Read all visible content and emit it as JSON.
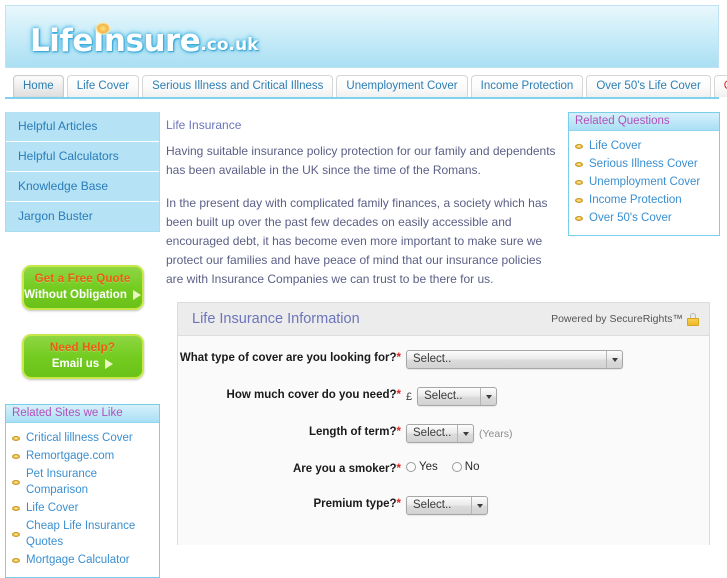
{
  "site": {
    "logo_main": "LifeInsure",
    "logo_tld": ".co.uk"
  },
  "nav": {
    "tabs": [
      {
        "label": "Home",
        "active": true
      },
      {
        "label": "Life Cover",
        "active": false
      },
      {
        "label": "Serious Illness and Critical Illness",
        "active": false
      },
      {
        "label": "Unemployment Cover",
        "active": false
      },
      {
        "label": "Income Protection",
        "active": false
      },
      {
        "label": "Over 50's Life Cover",
        "active": false
      },
      {
        "label": "Get a Quote",
        "active": false,
        "style": "quote"
      }
    ]
  },
  "sidebar_left": {
    "nav_items": [
      {
        "label": "Helpful Articles"
      },
      {
        "label": "Helpful Calculators"
      },
      {
        "label": "Knowledge Base"
      },
      {
        "label": "Jargon Buster"
      }
    ],
    "cta_quote": {
      "top": "Get a Free Quote",
      "bottom": "Without Obligation"
    },
    "cta_help": {
      "top": "Need Help?",
      "bottom": "Email us"
    },
    "related_sites": {
      "title": "Related Sites we Like",
      "links": [
        "Critical lillness Cover",
        "Remortgage.com",
        "Pet Insurance Comparison",
        "Life Cover",
        "Cheap Life Insurance Quotes",
        "Mortgage Calculator"
      ]
    }
  },
  "main": {
    "title": "Life Insurance",
    "paragraphs": [
      "Having suitable insurance policy protection for our family and dependents has been available in the UK since the time of the Romans.",
      "In the present day with complicated family finances, a society which has been built up over the past few decades on easily accessible and encouraged debt, it has become even more important to make sure we protect our families and have peace of mind that our insurance policies are with Insurance Companies we can trust to be there for us."
    ]
  },
  "sidebar_right": {
    "related_questions": {
      "title": "Related Questions",
      "links": [
        "Life Cover",
        "Serious Illness Cover",
        "Unemployment Cover",
        "Income Protection",
        "Over 50's Cover"
      ]
    }
  },
  "form": {
    "title": "Life Insurance Information",
    "powered_by": "Powered by SecureRights™",
    "fields": {
      "cover_type": {
        "label": "What type of cover are you looking for?",
        "required_mark": "*",
        "value": "Select.."
      },
      "cover_amount": {
        "label": "How much cover do you need?",
        "required_mark": "*",
        "currency": "£",
        "value": "Select.."
      },
      "term_length": {
        "label": "Length of term?",
        "required_mark": "*",
        "value": "Select..",
        "hint": "(Years)"
      },
      "smoker": {
        "label": "Are you a smoker?",
        "required_mark": "*",
        "options": [
          "Yes",
          "No"
        ]
      },
      "premium_type": {
        "label": "Premium type?",
        "required_mark": "*",
        "value": "Select.."
      }
    }
  }
}
